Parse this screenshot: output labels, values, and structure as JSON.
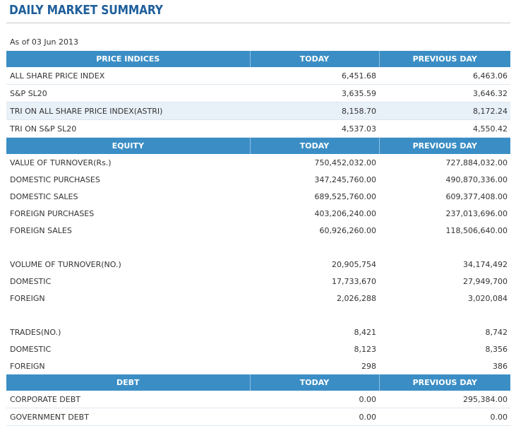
{
  "page": {
    "title": "DAILY MARKET SUMMARY",
    "as_of": "As of 03 Jun 2013"
  },
  "columns": {
    "today": "TODAY",
    "previous_day": "PREVIOUS DAY"
  },
  "price_indices": {
    "header": "PRICE INDICES",
    "rows": [
      {
        "label": "ALL SHARE PRICE INDEX",
        "today": "6,451.68",
        "previous": "6,463.06"
      },
      {
        "label": "S&P SL20",
        "today": "3,635.59",
        "previous": "3,646.32"
      },
      {
        "label": "TRI ON ALL SHARE PRICE INDEX(ASTRI)",
        "today": "8,158.70",
        "previous": "8,172.24"
      },
      {
        "label": "TRI ON S&P SL20",
        "today": "4,537.03",
        "previous": "4,550.42"
      }
    ]
  },
  "equity": {
    "header": "EQUITY",
    "rows": [
      {
        "label": "VALUE OF TURNOVER(Rs.)",
        "today": "750,452,032.00",
        "previous": "727,884,032.00"
      },
      {
        "label": "DOMESTIC PURCHASES",
        "today": "347,245,760.00",
        "previous": "490,870,336.00"
      },
      {
        "label": "DOMESTIC SALES",
        "today": "689,525,760.00",
        "previous": "609,377,408.00"
      },
      {
        "label": "FOREIGN PURCHASES",
        "today": "403,206,240.00",
        "previous": "237,013,696.00"
      },
      {
        "label": "FOREIGN SALES",
        "today": "60,926,260.00",
        "previous": "118,506,640.00"
      }
    ],
    "volume_rows": [
      {
        "label": "VOLUME OF TURNOVER(NO.)",
        "today": "20,905,754",
        "previous": "34,174,492"
      },
      {
        "label": "DOMESTIC",
        "today": "17,733,670",
        "previous": "27,949,700"
      },
      {
        "label": "FOREIGN",
        "today": "2,026,288",
        "previous": "3,020,084"
      }
    ],
    "trades_rows": [
      {
        "label": "TRADES(NO.)",
        "today": "8,421",
        "previous": "8,742"
      },
      {
        "label": "DOMESTIC",
        "today": "8,123",
        "previous": "8,356"
      },
      {
        "label": "FOREIGN",
        "today": "298",
        "previous": "386"
      }
    ]
  },
  "debt": {
    "header": "DEBT",
    "rows": [
      {
        "label": "CORPORATE DEBT",
        "today": "0.00",
        "previous": "295,384.00"
      },
      {
        "label": "GOVERNMENT DEBT",
        "today": "0.00",
        "previous": "0.00"
      }
    ]
  }
}
